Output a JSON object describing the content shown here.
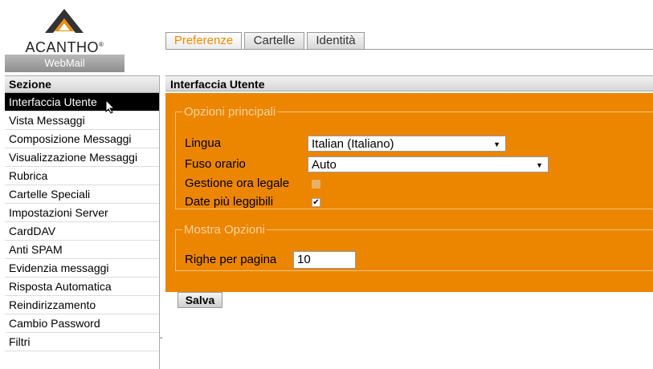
{
  "logo": {
    "name": "ACANTHO",
    "registered": "®",
    "product": "WebMail"
  },
  "tabs": [
    {
      "label": "Preferenze",
      "active": true
    },
    {
      "label": "Cartelle",
      "active": false
    },
    {
      "label": "Identità",
      "active": false
    }
  ],
  "sidebar": {
    "title": "Sezione",
    "items": [
      {
        "label": "Interfaccia Utente",
        "selected": true
      },
      {
        "label": "Vista Messaggi"
      },
      {
        "label": "Composizione Messaggi"
      },
      {
        "label": "Visualizzazione Messaggi"
      },
      {
        "label": "Rubrica"
      },
      {
        "label": "Cartelle Speciali"
      },
      {
        "label": "Impostazioni Server"
      },
      {
        "label": "CardDAV"
      },
      {
        "label": "Anti SPAM"
      },
      {
        "label": "Evidenzia messaggi"
      },
      {
        "label": "Risposta Automatica"
      },
      {
        "label": "Reindirizzamento"
      },
      {
        "label": "Cambio Password"
      },
      {
        "label": "Filtri"
      }
    ]
  },
  "main": {
    "title": "Interfaccia Utente",
    "main_options": {
      "legend": "Opzioni principali",
      "language_label": "Lingua",
      "language_value": "Italian (Italiano)",
      "timezone_label": "Fuso orario",
      "timezone_value": "Auto",
      "dst_label": "Gestione ora legale",
      "dst_checked": false,
      "dst_disabled": true,
      "pretty_dates_label": "Date più leggibili",
      "pretty_dates_checked": true
    },
    "display_options": {
      "legend": "Mostra Opzioni",
      "rows_per_page_label": "Righe per pagina",
      "rows_per_page_value": "10"
    },
    "save_label": "Salva"
  },
  "icons": {
    "dropdown": "triangle-down-icon",
    "checkbox_check": "checkmark-icon",
    "splitter": "caret-up-icon",
    "cursor": "mouse-pointer-icon"
  },
  "colors": {
    "accent": "#f08a00",
    "panel": "#ec8500",
    "selected_bg": "#000000"
  }
}
